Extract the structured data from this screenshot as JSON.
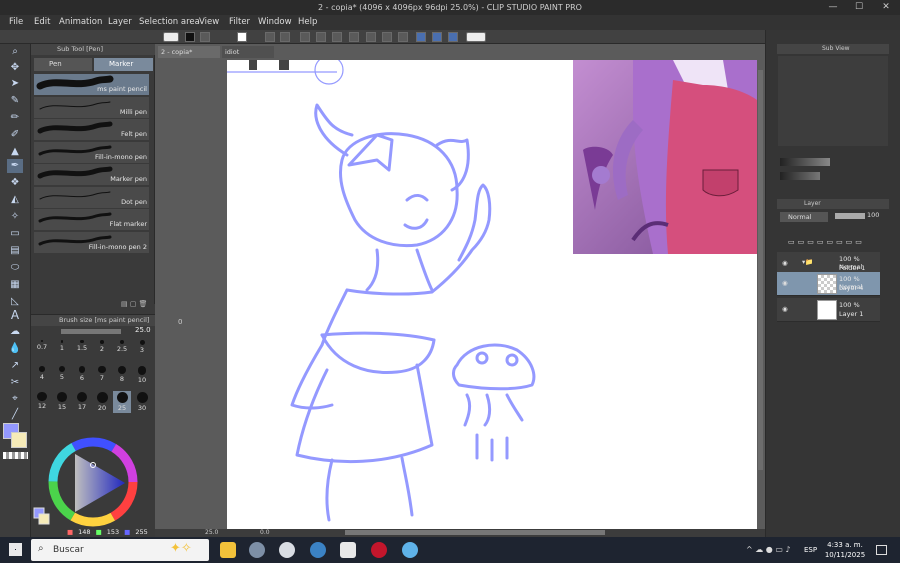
{
  "window": {
    "title": "2 - copia* (4096 x 4096px 96dpi 25.0%) - CLIP STUDIO PAINT PRO",
    "minimize": "—",
    "maximize": "☐",
    "close": "✕"
  },
  "menu": [
    "File",
    "Edit",
    "Animation",
    "Layer",
    "Selection area",
    "View",
    "Filter",
    "Window",
    "Help"
  ],
  "subtool": {
    "header": "Sub Tool [Pen]",
    "tabs": [
      "Pen",
      "Marker"
    ],
    "brushes": [
      "ms paint pencil",
      "Milli pen",
      "Felt pen",
      "Fill-in-mono pen",
      "Marker pen",
      "Dot pen",
      "Flat marker",
      "Fill-in-mono pen 2"
    ]
  },
  "brush_size": {
    "header": "Brush size [ms paint pencil]",
    "value": "25.0",
    "sizes": [
      "0.7",
      "1",
      "1.5",
      "2",
      "2.5",
      "3",
      "4",
      "5",
      "6",
      "7",
      "8",
      "10",
      "12",
      "15",
      "17",
      "20",
      "25",
      "30"
    ],
    "selected": "25"
  },
  "canvas": {
    "tabs": [
      "2 - copia*",
      "idiot"
    ],
    "zoom": "25.0",
    "rotation": "0.0",
    "side_marker": "0"
  },
  "color": {
    "r": "148",
    "g": "153",
    "b": "255",
    "main_hex": "#9499ff",
    "sub_hex": "#f6ebb8"
  },
  "subview": {
    "header": "Sub View"
  },
  "layer_panel": {
    "header": "Layer",
    "blend_mode": "Normal",
    "opacity": "100",
    "layers": [
      {
        "meta": "100 % Normal",
        "name": "Folder 1"
      },
      {
        "meta": "100 % Normal",
        "name": "Layer 4"
      },
      {
        "meta": "100 %",
        "name": "Layer 1"
      }
    ]
  },
  "taskbar": {
    "search_placeholder": "Buscar",
    "lang": "ESP",
    "time": "4:33 a. m.",
    "date": "10/11/2025"
  }
}
